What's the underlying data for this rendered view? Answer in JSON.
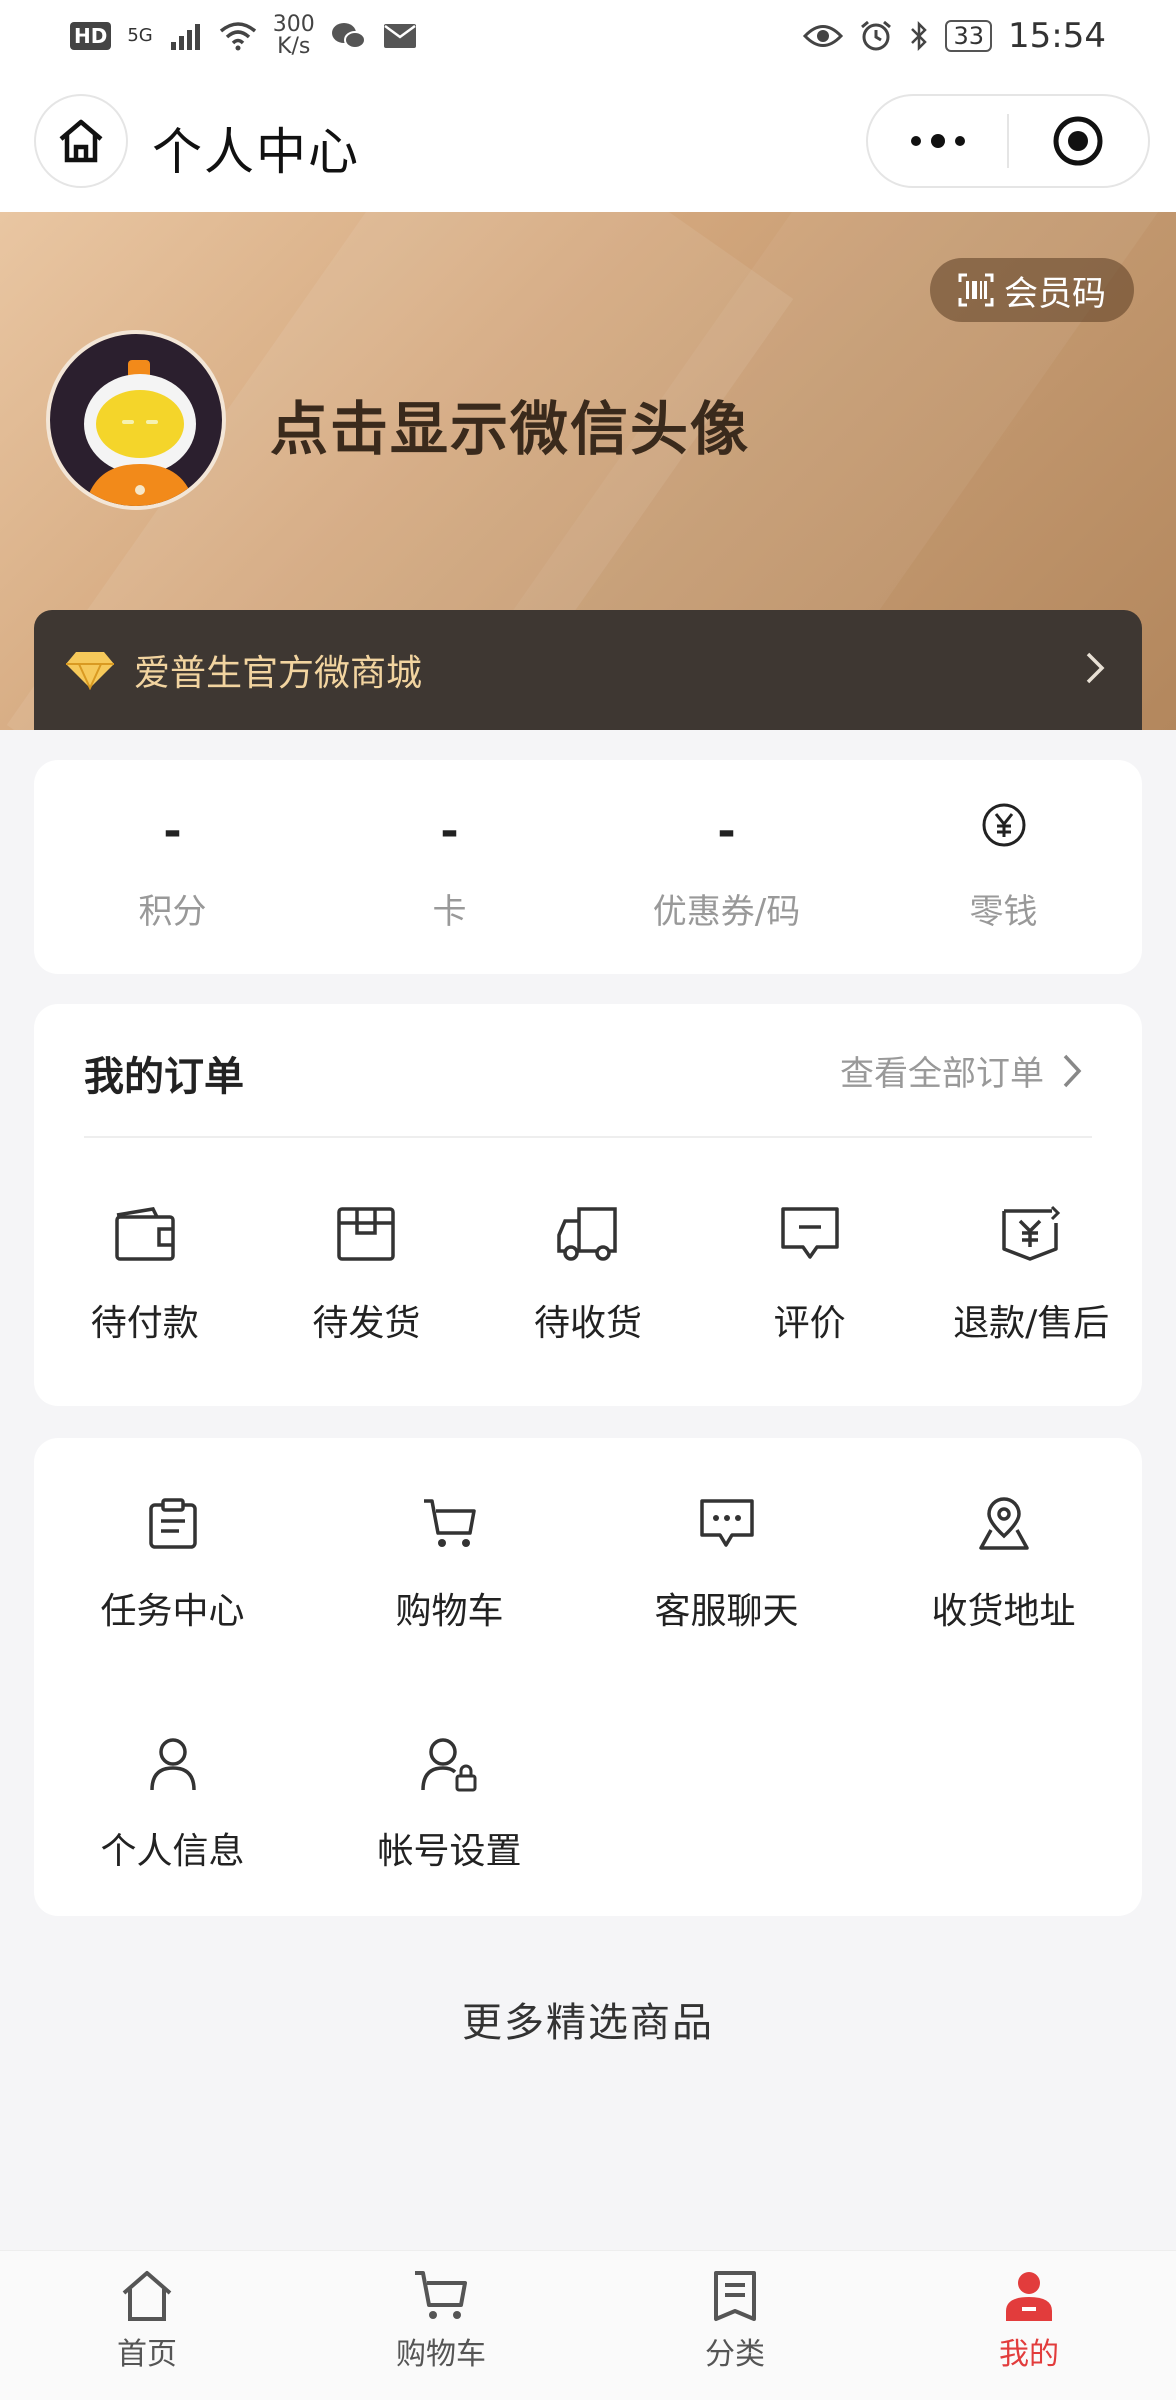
{
  "status_bar": {
    "hd": "HD",
    "network": "5G",
    "speed": "300",
    "speed_unit": "K/s",
    "battery": "33",
    "time": "15:54"
  },
  "nav": {
    "title": "个人中心"
  },
  "profile": {
    "member_code_label": "会员码",
    "name_prompt": "点击显示微信头像",
    "shop_name": "爱普生官方微商城"
  },
  "assets": [
    {
      "value": "-",
      "label": "积分"
    },
    {
      "value": "-",
      "label": "卡"
    },
    {
      "value": "-",
      "label": "优惠券/码"
    },
    {
      "value": "",
      "label": "零钱",
      "icon": "yuan-icon"
    }
  ],
  "orders": {
    "title": "我的订单",
    "view_all": "查看全部订单",
    "items": [
      {
        "label": "待付款",
        "icon": "wallet-icon"
      },
      {
        "label": "待发货",
        "icon": "package-icon"
      },
      {
        "label": "待收货",
        "icon": "truck-icon"
      },
      {
        "label": "评价",
        "icon": "comment-icon"
      },
      {
        "label": "退款/售后",
        "icon": "refund-icon"
      }
    ]
  },
  "tools": [
    {
      "label": "任务中心",
      "icon": "clipboard-icon"
    },
    {
      "label": "购物车",
      "icon": "cart-icon"
    },
    {
      "label": "客服聊天",
      "icon": "chat-icon"
    },
    {
      "label": "收货地址",
      "icon": "location-icon"
    },
    {
      "label": "个人信息",
      "icon": "user-icon"
    },
    {
      "label": "帐号设置",
      "icon": "user-lock-icon"
    }
  ],
  "more_goods": "更多精选商品",
  "tabbar": [
    {
      "label": "首页",
      "icon": "home-icon"
    },
    {
      "label": "购物车",
      "icon": "cart-icon"
    },
    {
      "label": "分类",
      "icon": "list-icon"
    },
    {
      "label": "我的",
      "icon": "my-icon",
      "active": true
    }
  ],
  "colors": {
    "accent": "#e23c3c",
    "hero_gold": "#c59b72",
    "shop_bar": "#3e3732",
    "shop_text": "#f2d4a0"
  }
}
